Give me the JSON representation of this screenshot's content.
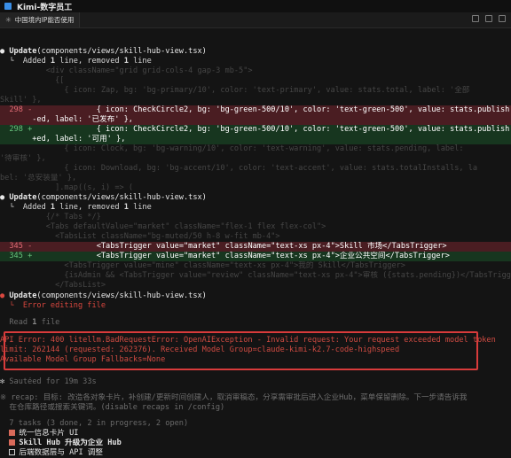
{
  "window": {
    "title": "Kimi-数字员工"
  },
  "tab": {
    "label": "中国境内IP能否使用"
  },
  "blocks": [
    {
      "cmd": "Update",
      "path": "(components/views/skill-hub-view.tsx)",
      "summary_pre": "Added ",
      "summary_n1": "1",
      "summary_mid": " line, removed ",
      "summary_n2": "1",
      "summary_post": " line",
      "ctx_before": [
        "          <div className=\"grid grid-cols-4 gap-3 mb-5\">",
        "            {[",
        "              { icon: Zap, bg: 'bg-primary/10', color: 'text-primary', value: stats.total, label: '全部",
        "Skill' },"
      ],
      "del": {
        "no": "298",
        "sign": "-",
        "text1": "              { icon: CheckCircle2, bg: 'bg-green-500/10', color: 'text-green-500', value: stats.publish",
        "text2": "-ed, label: '已发布' },"
      },
      "add": {
        "no": "298",
        "sign": "+",
        "text1": "              { icon: CheckCircle2, bg: 'bg-green-500/10', color: 'text-green-500', value: stats.publish",
        "text2": "+ed, label: '可用' },"
      },
      "ctx_after": [
        "              { icon: Clock, bg: 'bg-warning/10', color: 'text-warning', value: stats.pending, label:",
        "'待审核' },",
        "              { icon: Download, bg: 'bg-accent/10', color: 'text-accent', value: stats.totalInstalls, la",
        "bel: '总安装量' },",
        "            ].map((s, i) => ("
      ]
    },
    {
      "cmd": "Update",
      "path": "(components/views/skill-hub-view.tsx)",
      "summary_pre": "Added ",
      "summary_n1": "1",
      "summary_mid": " line, removed ",
      "summary_n2": "1",
      "summary_post": " line",
      "ctx_before": [
        "          {/* Tabs */}",
        "          <Tabs defaultValue=\"market\" className=\"flex-1 flex flex-col\">",
        "            <TabsList className=\"bg-muted/50 h-8 w-fit mb-4\">"
      ],
      "del": {
        "no": "345",
        "sign": "-",
        "text1": "              <TabsTrigger value=\"market\" className=\"text-xs px-4\">Skill 市场</TabsTrigger>"
      },
      "add": {
        "no": "345",
        "sign": "+",
        "text1": "              <TabsTrigger value=\"market\" className=\"text-xs px-4\">企业公共空间</TabsTrigger>"
      },
      "ctx_after": [
        "              <TabsTrigger value=\"mine\" className=\"text-xs px-4\">我的 Skill</TabsTrigger>",
        "              {isAdmin && <TabsTrigger value=\"review\" className=\"text-xs px-4\">审核 ({stats.pending})</TabsTrigger>}",
        "            </TabsList>"
      ]
    }
  ],
  "third_update": {
    "cmd": "Update",
    "path": "(components/views/skill-hub-view.tsx)",
    "error": "Error editing file"
  },
  "read": {
    "pre": "Read ",
    "n": "1",
    "post": " file"
  },
  "api_error": {
    "line1": "API Error: 400 litellm.BadRequestError: OpenAIException - Invalid request: Your request exceeded model token",
    "line2": "limit: 262144 (requested: 262376). Received Model Group=claude-kimi-k2.7-code-highspeed",
    "line3": "Available Model Group Fallbacks=None"
  },
  "sauteed": "Sautéed for 19m 33s",
  "recap": {
    "line1": "※ recap: 目标: 改造各对象卡片，补创建/更新时间创建人，取消审稿态，分享需审批后进入企业Hub，菜单保留删除。下一步请告诉我",
    "line2": "  在仓库路径或搜索关键词。(disable recaps in /config)"
  },
  "tasks": {
    "summary": "7 tasks (3 done, 2 in progress, 2 open)",
    "items": [
      {
        "label": "统一信息卡片 UI",
        "state": "done"
      },
      {
        "label": "Skill Hub 升级为企业 Hub",
        "state": "done"
      },
      {
        "label": "后端数据层与 API 调整",
        "state": "open"
      }
    ]
  }
}
